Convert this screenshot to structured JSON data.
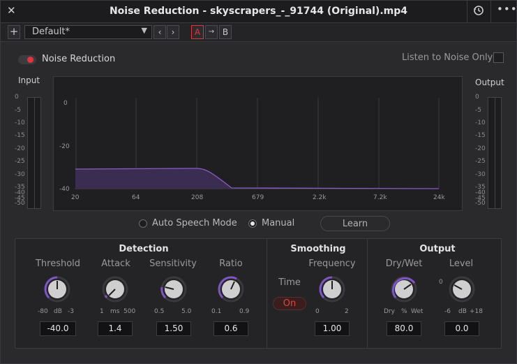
{
  "window": {
    "title": "Noise Reduction - skyscrapers_-_91744 (Original).mp4"
  },
  "toolbar": {
    "preset": "Default*",
    "ab": [
      "A",
      "→",
      "B"
    ]
  },
  "header": {
    "toggle_label": "Noise Reduction",
    "listen_label": "Listen to Noise Only"
  },
  "meters": {
    "input_label": "Input",
    "output_label": "Output",
    "ticks": [
      "0",
      "-5",
      "-10",
      "-15",
      "-20",
      "-25",
      "-30",
      "-35",
      "-40",
      "-45",
      "-50"
    ]
  },
  "graph": {
    "y_labels": [
      "0",
      "-20",
      "-40"
    ],
    "x_labels": [
      "20",
      "64",
      "208",
      "679",
      "2.2k",
      "7.2k",
      "24k"
    ]
  },
  "mode": {
    "auto": "Auto Speech Mode",
    "manual": "Manual",
    "learn": "Learn",
    "selected": "Manual"
  },
  "detection": {
    "title": "Detection",
    "threshold": {
      "label": "Threshold",
      "min": "-80",
      "unit": "dB",
      "max": "-3",
      "value": "-40.0"
    },
    "attack": {
      "label": "Attack",
      "min": "1",
      "unit": "ms",
      "max": "500",
      "value": "1.4"
    },
    "sensitivity": {
      "label": "Sensitivity",
      "min": "0.5",
      "max": "5.0",
      "value": "1.50"
    },
    "ratio": {
      "label": "Ratio",
      "min": "0.1",
      "max": "0.9",
      "value": "0.6"
    }
  },
  "smoothing": {
    "title": "Smoothing",
    "time_label": "Time",
    "time_state": "On",
    "frequency": {
      "label": "Frequency",
      "min": "0",
      "max": "2",
      "value": "1.00"
    }
  },
  "output": {
    "title": "Output",
    "drywet": {
      "label": "Dry/Wet",
      "min": "Dry",
      "unit": "%",
      "max": "Wet",
      "value": "80.0"
    },
    "level": {
      "label": "Level",
      "zero": "0",
      "min": "-6",
      "unit": "dB",
      "max": "+18",
      "value": "0.0"
    }
  },
  "colors": {
    "accent": "#7e55c8",
    "toggle_on": "#e4363a",
    "curve": "#8a5cc4"
  }
}
